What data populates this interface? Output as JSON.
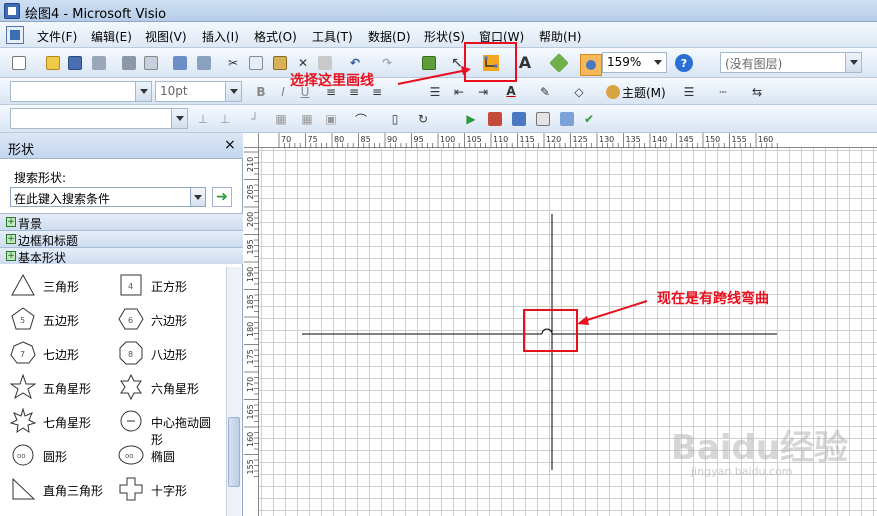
{
  "window": {
    "title": "绘图4 - Microsoft Visio"
  },
  "menu": [
    "文件(F)",
    "编辑(E)",
    "视图(V)",
    "插入(I)",
    "格式(O)",
    "工具(T)",
    "数据(D)",
    "形状(S)",
    "窗口(W)",
    "帮助(H)"
  ],
  "toolbar": {
    "zoom": "159%",
    "layer_placeholder": "(没有图层)",
    "font_size": "10pt",
    "theme_label": "主题(M)"
  },
  "annotations": {
    "connector_tip": "选择这里画线",
    "jump_tip": "现在是有跨线弯曲"
  },
  "panel": {
    "title": "形状",
    "close": "×",
    "search_label": "搜索形状:",
    "search_placeholder": "在此键入搜索条件",
    "stencils": [
      "背景",
      "边框和标题",
      "基本形状"
    ],
    "shapes": [
      {
        "label": "三角形",
        "icon": "triangle-icon"
      },
      {
        "label": "正方形",
        "icon": "square-icon"
      },
      {
        "label": "五边形",
        "icon": "pentagon-icon"
      },
      {
        "label": "六边形",
        "icon": "hexagon-icon"
      },
      {
        "label": "七边形",
        "icon": "heptagon-icon"
      },
      {
        "label": "八边形",
        "icon": "octagon-icon"
      },
      {
        "label": "五角星形",
        "icon": "star5-icon"
      },
      {
        "label": "六角星形",
        "icon": "star6-icon"
      },
      {
        "label": "七角星形",
        "icon": "star7-icon"
      },
      {
        "label": "中心拖动圆形",
        "icon": "center-circle-icon"
      },
      {
        "label": "圆形",
        "icon": "circle-icon"
      },
      {
        "label": "椭圆",
        "icon": "ellipse-icon"
      },
      {
        "label": "直角三角形",
        "icon": "right-triangle-icon"
      },
      {
        "label": "十字形",
        "icon": "cross-icon"
      }
    ]
  },
  "ruler": {
    "h_labels": [
      "70",
      "75",
      "80",
      "85",
      "90",
      "95",
      "100",
      "105",
      "110",
      "115",
      "120",
      "125",
      "130",
      "135",
      "140",
      "145",
      "150",
      "155",
      "160"
    ],
    "v_labels": [
      "210",
      "205",
      "200",
      "195",
      "190",
      "185",
      "180",
      "175",
      "170",
      "165",
      "160",
      "155"
    ]
  },
  "watermark": {
    "text": "Baidu经验",
    "sub": "jingyan.baidu.com"
  },
  "colors": {
    "accent_red": "#e8101e",
    "connector_orange": "#f5a623"
  }
}
